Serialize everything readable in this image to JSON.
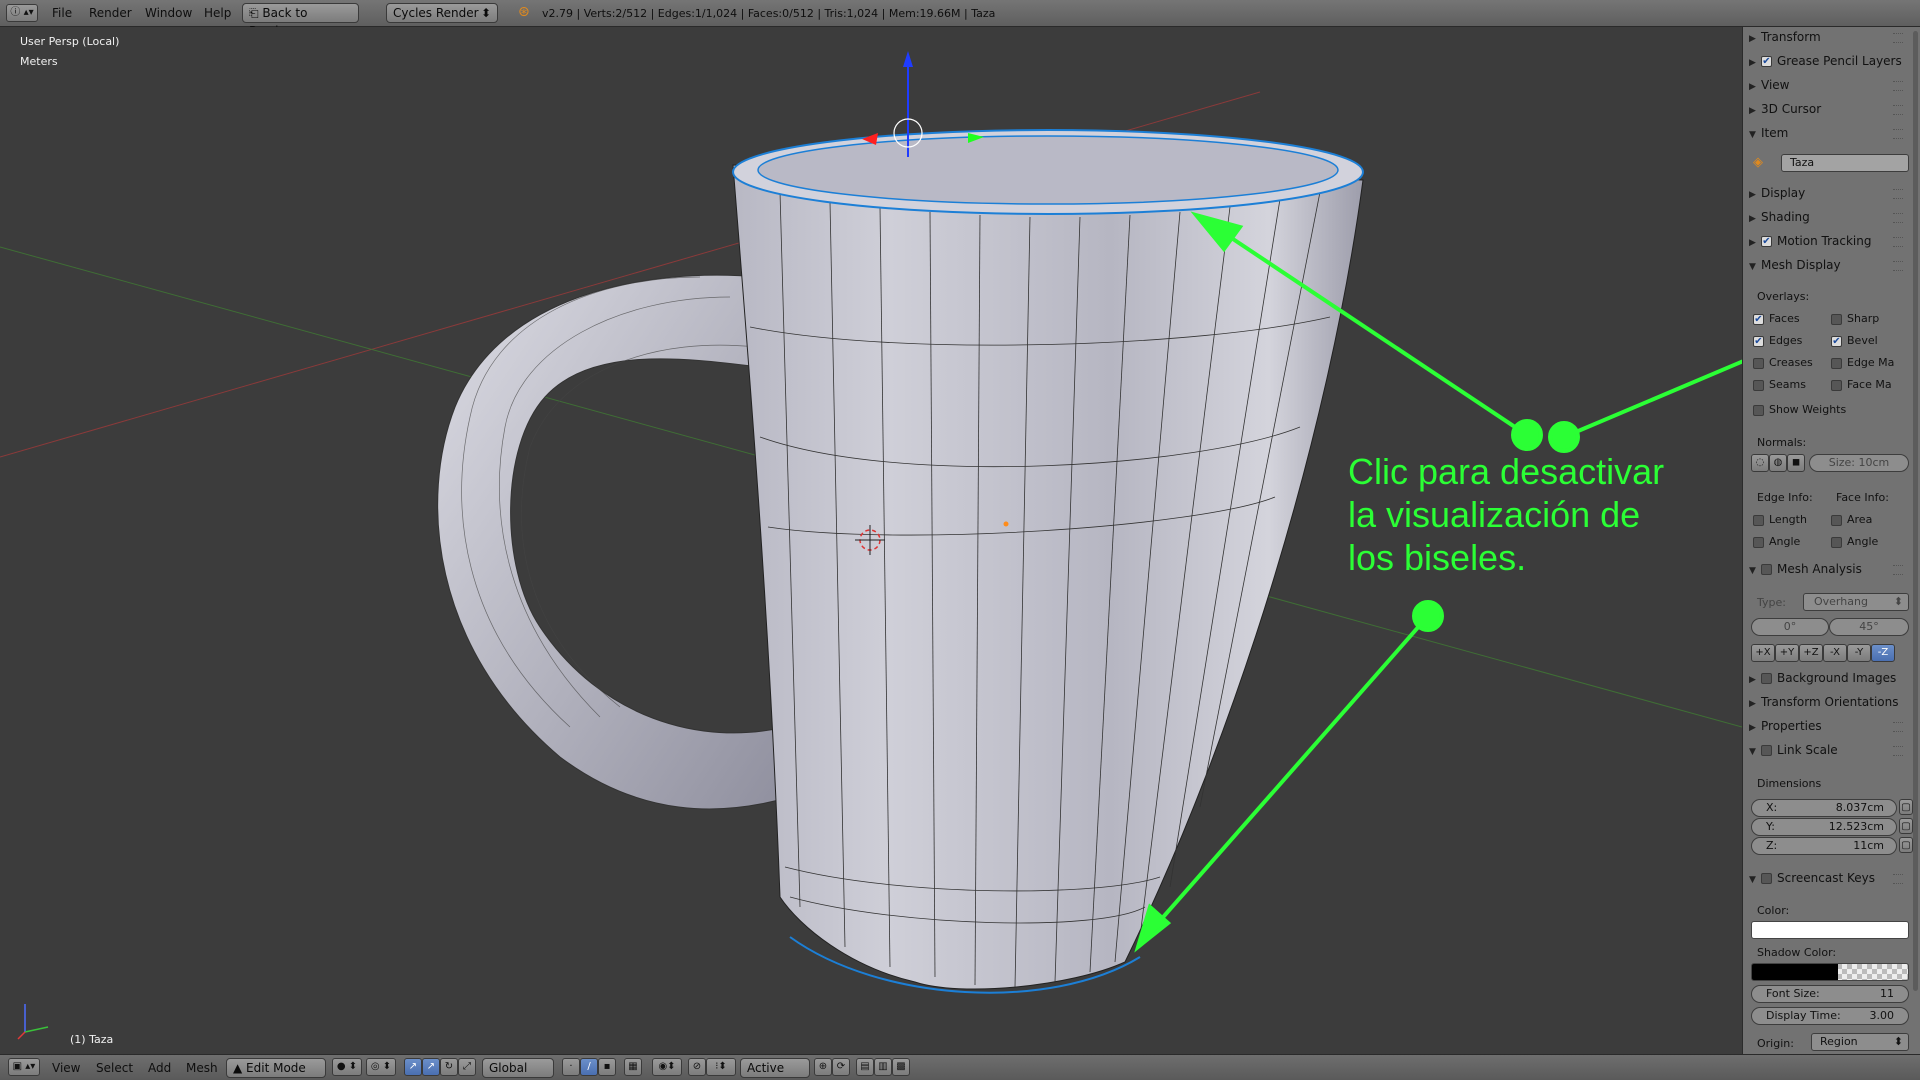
{
  "topbar": {
    "menus": [
      "File",
      "Render",
      "Window",
      "Help"
    ],
    "back_button": "Back to Previous",
    "render_engine": "Cycles Render",
    "stats": "v2.79 | Verts:2/512 | Edges:1/1,024 | Faces:0/512 | Tris:1,024 | Mem:19.66M | Taza"
  },
  "viewport": {
    "view_name": "User Persp (Local)",
    "units": "Meters",
    "object_label": "(1) Taza",
    "annotation": [
      "Clic para desactivar",
      "la visualización de",
      "los biseles."
    ]
  },
  "bottombar": {
    "menus": [
      "View",
      "Select",
      "Add",
      "Mesh"
    ],
    "mode": "Edit Mode",
    "orientation": "Global",
    "pivot": "Active"
  },
  "sidepanel": {
    "panels": {
      "transform": "Transform",
      "grease_pencil": "Grease Pencil Layers",
      "view": "View",
      "cursor": "3D Cursor",
      "item": "Item",
      "display": "Display",
      "shading": "Shading",
      "motion_tracking": "Motion Tracking",
      "mesh_display": "Mesh Display",
      "mesh_analysis": "Mesh Analysis",
      "background_images": "Background Images",
      "transform_orientations": "Transform Orientations",
      "properties": "Properties",
      "link_scale": "Link Scale",
      "screencast_keys": "Screencast Keys"
    },
    "item_name": "Taza",
    "overlays_label": "Overlays:",
    "overlays": {
      "faces": "Faces",
      "sharp": "Sharp",
      "edges": "Edges",
      "bevel": "Bevel",
      "creases": "Creases",
      "edge_marks": "Edge Ma",
      "seams": "Seams",
      "face_marks": "Face Ma",
      "show_weights": "Show Weights"
    },
    "normals_label": "Normals:",
    "normals_size": "Size: 10cm",
    "edge_info_label": "Edge Info:",
    "face_info_label": "Face Info:",
    "edge_info": [
      "Length",
      "Angle"
    ],
    "face_info": [
      "Area",
      "Angle"
    ],
    "analysis_type_label": "Type:",
    "analysis_type": "Overhang",
    "analysis_min": "0°",
    "analysis_max": "45°",
    "axis_buttons": [
      "+X",
      "+Y",
      "+Z",
      "-X",
      "-Y",
      "-Z"
    ],
    "dimensions_label": "Dimensions",
    "dimensions": {
      "x": "X:",
      "x_val": "8.037cm",
      "y": "Y:",
      "y_val": "12.523cm",
      "z": "Z:",
      "z_val": "11cm"
    },
    "color_label": "Color:",
    "shadow_color_label": "Shadow Color:",
    "font_size_label": "Font Size:",
    "font_size": "11",
    "display_time_label": "Display Time:",
    "display_time": "3.00",
    "origin_label": "Origin:",
    "origin_value": "Region"
  },
  "colors": {
    "annotation": "#2bff35",
    "mug": "#c9c9d4",
    "selection": "#1c7fd6"
  }
}
